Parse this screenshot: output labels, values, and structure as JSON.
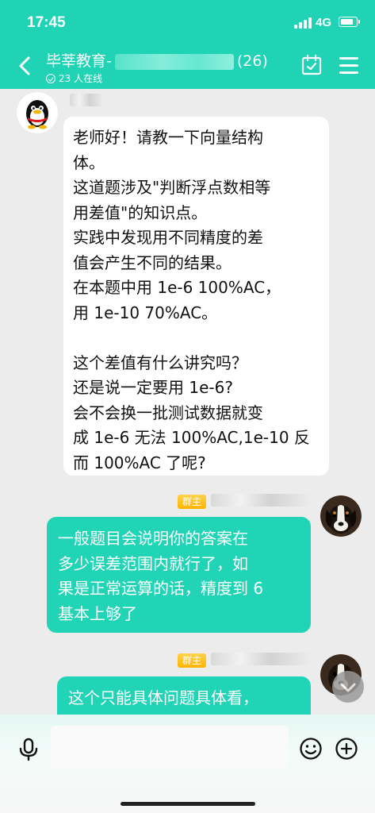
{
  "status_bar": {
    "time": "17:45",
    "network": "4G"
  },
  "header": {
    "title_prefix": "毕莘教育-",
    "title_suffix": "(26)",
    "online": "23 人在线"
  },
  "messages": [
    {
      "side": "left",
      "text": "老师好！请教一下向量结构\n体。\n这道题涉及\"判断浮点数相等\n用差值\"的知识点。\n实践中发现用不同精度的差\n值会产生不同的结果。\n在本题中用 1e-6 100%AC，\n用 1e-10 70%AC。\n\n这个差值有什么讲究吗？\n还是说一定要用 1e-6?\n会不会换一批测试数据就变\n成 1e-6 无法 100%AC,1e-10 反\n而 100%AC 了呢?"
    },
    {
      "side": "right",
      "badge": "群主",
      "text": "一般题目会说明你的答案在\n多少误差范围内就行了，如\n果是正常运算的话，精度到 6\n基本上够了"
    },
    {
      "side": "right",
      "badge": "群主",
      "text": "这个只能具体问题具体看，"
    }
  ],
  "colors": {
    "accent": "#20d3b4",
    "bubble_right": "#22d4b6",
    "badge": "#ffb400"
  }
}
